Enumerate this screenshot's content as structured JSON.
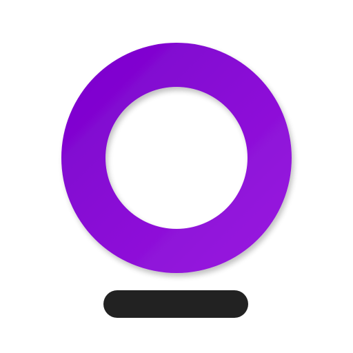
{
  "logo": {
    "icon": "ring-o-icon",
    "ring_color_start": "#7a00cc",
    "ring_color_end": "#9a1be0",
    "hole_color": "#ffffff",
    "bar_color": "#222222"
  }
}
